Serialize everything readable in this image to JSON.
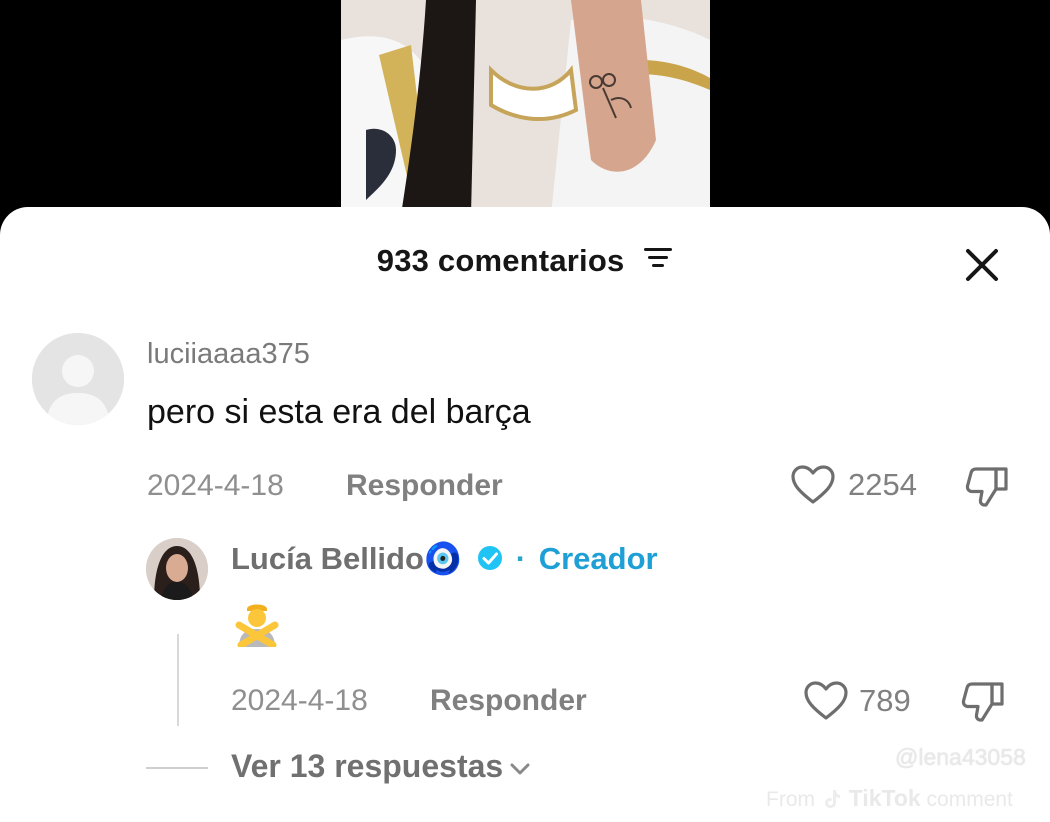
{
  "header": {
    "comment_count_label": "933 comentarios"
  },
  "comments": [
    {
      "username": "luciiaaaa375",
      "text": "pero si esta era del barça",
      "date": "2024-4-18",
      "reply_label": "Responder",
      "likes": "2254",
      "replies": [
        {
          "username": "Lucía Bellido🧿",
          "badge_separator": "·",
          "badge": "Creador",
          "text": "🙅‍♂️",
          "date": "2024-4-18",
          "reply_label": "Responder",
          "likes": "789"
        }
      ],
      "view_replies_label": "Ver 13 respuestas"
    }
  ],
  "watermark": {
    "handle": "@lena43058",
    "from_label": "From",
    "brand": "TikTok",
    "suffix": "comment"
  },
  "colors": {
    "sheet_background": "#ffffff",
    "creator_badge": "#1ea0d6",
    "verified_badge": "#20c4f4",
    "muted_text": "#8f8f8f"
  }
}
